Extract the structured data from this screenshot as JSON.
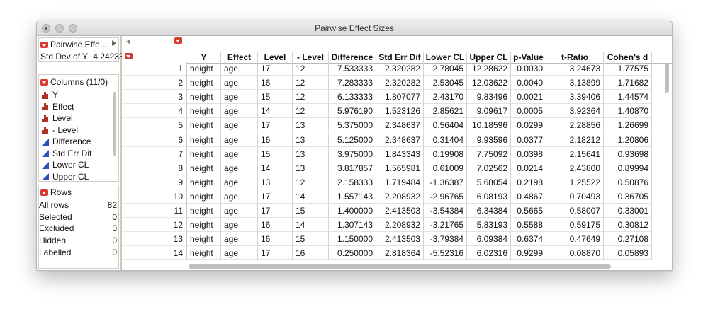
{
  "window": {
    "title": "Pairwise Effect Sizes"
  },
  "left_panel": {
    "table_name": "Pairwise Effe…",
    "table_var_label": "Std Dev of Y",
    "table_var_value": "4.24233",
    "columns_header": "Columns (11/0)",
    "columns": [
      {
        "label": "Y",
        "icon": "nominal-bar-icon"
      },
      {
        "label": "Effect",
        "icon": "nominal-bar-icon"
      },
      {
        "label": "Level",
        "icon": "nominal-bar-icon"
      },
      {
        "label": "- Level",
        "icon": "nominal-bar-icon"
      },
      {
        "label": "Difference",
        "icon": "continuous-triangle-icon"
      },
      {
        "label": "Std Err Dif",
        "icon": "continuous-triangle-icon"
      },
      {
        "label": "Lower CL",
        "icon": "continuous-triangle-icon"
      },
      {
        "label": "Upper CL",
        "icon": "continuous-triangle-icon"
      }
    ],
    "rows_header": "Rows",
    "rows_stats": [
      {
        "label": "All rows",
        "value": "82"
      },
      {
        "label": "Selected",
        "value": "0"
      },
      {
        "label": "Excluded",
        "value": "0"
      },
      {
        "label": "Hidden",
        "value": "0"
      },
      {
        "label": "Labelled",
        "value": "0"
      }
    ]
  },
  "table": {
    "headers": [
      "Y",
      "Effect",
      "Level",
      "- Level",
      "Difference",
      "Std Err Dif",
      "Lower CL",
      "Upper CL",
      "p-Value",
      "t-Ratio",
      "Cohen's d"
    ],
    "rows": [
      [
        "1",
        "height",
        "age",
        "17",
        "12",
        "7.533333",
        "2.320282",
        "2.78045",
        "12.28622",
        "0.0030",
        "3.24673",
        "1.77575"
      ],
      [
        "2",
        "height",
        "age",
        "16",
        "12",
        "7.283333",
        "2.320282",
        "2.53045",
        "12.03622",
        "0.0040",
        "3.13899",
        "1.71682"
      ],
      [
        "3",
        "height",
        "age",
        "15",
        "12",
        "6.133333",
        "1.807077",
        "2.43170",
        "9.83496",
        "0.0021",
        "3.39406",
        "1.44574"
      ],
      [
        "4",
        "height",
        "age",
        "14",
        "12",
        "5.976190",
        "1.523126",
        "2.85621",
        "9.09617",
        "0.0005",
        "3.92364",
        "1.40870"
      ],
      [
        "5",
        "height",
        "age",
        "17",
        "13",
        "5.375000",
        "2.348637",
        "0.56404",
        "10.18596",
        "0.0299",
        "2.28856",
        "1.26699"
      ],
      [
        "6",
        "height",
        "age",
        "16",
        "13",
        "5.125000",
        "2.348637",
        "0.31404",
        "9.93596",
        "0.0377",
        "2.18212",
        "1.20806"
      ],
      [
        "7",
        "height",
        "age",
        "15",
        "13",
        "3.975000",
        "1.843343",
        "0.19908",
        "7.75092",
        "0.0398",
        "2.15641",
        "0.93698"
      ],
      [
        "8",
        "height",
        "age",
        "14",
        "13",
        "3.817857",
        "1.565981",
        "0.61009",
        "7.02562",
        "0.0214",
        "2.43800",
        "0.89994"
      ],
      [
        "9",
        "height",
        "age",
        "13",
        "12",
        "2.158333",
        "1.719484",
        "-1.36387",
        "5.68054",
        "0.2198",
        "1.25522",
        "0.50876"
      ],
      [
        "10",
        "height",
        "age",
        "17",
        "14",
        "1.557143",
        "2.208932",
        "-2.96765",
        "6.08193",
        "0.4867",
        "0.70493",
        "0.36705"
      ],
      [
        "11",
        "height",
        "age",
        "17",
        "15",
        "1.400000",
        "2.413503",
        "-3.54384",
        "6.34384",
        "0.5665",
        "0.58007",
        "0.33001"
      ],
      [
        "12",
        "height",
        "age",
        "16",
        "14",
        "1.307143",
        "2.208932",
        "-3.21765",
        "5.83193",
        "0.5588",
        "0.59175",
        "0.30812"
      ],
      [
        "13",
        "height",
        "age",
        "16",
        "15",
        "1.150000",
        "2.413503",
        "-3.79384",
        "6.09384",
        "0.6374",
        "0.47649",
        "0.27108"
      ],
      [
        "14",
        "height",
        "age",
        "17",
        "16",
        "0.250000",
        "2.818364",
        "-5.52316",
        "6.02316",
        "0.9299",
        "0.08870",
        "0.05893"
      ]
    ]
  }
}
